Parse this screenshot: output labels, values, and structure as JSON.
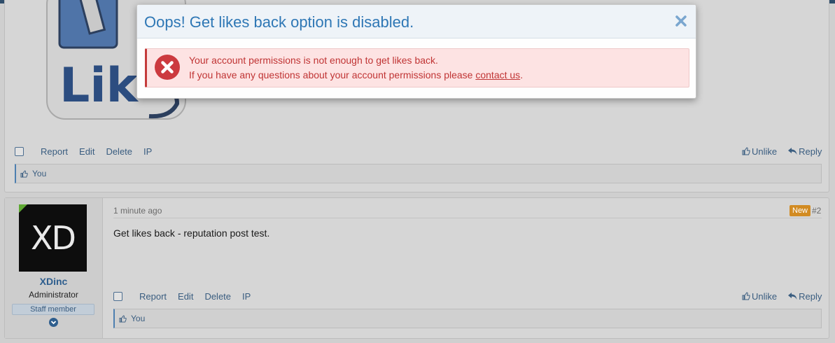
{
  "post1": {
    "image_text": "Lik",
    "actions": {
      "report": "Report",
      "edit": "Edit",
      "delete": "Delete",
      "ip": "IP",
      "unlike": "Unlike",
      "reply": "Reply"
    },
    "likes_text": "You"
  },
  "post2": {
    "avatar_text": "XD",
    "username": "XDinc",
    "user_title": "Administrator",
    "user_badge": "Staff member",
    "time": "1 minute ago",
    "new_badge": "New",
    "post_number": "#2",
    "body": "Get likes back - reputation post test.",
    "actions": {
      "report": "Report",
      "edit": "Edit",
      "delete": "Delete",
      "ip": "IP",
      "unlike": "Unlike",
      "reply": "Reply"
    },
    "likes_text": "You"
  },
  "modal": {
    "title": "Oops! Get likes back option is disabled.",
    "message_line1": "Your account permissions is not enough to get likes back.",
    "message_line2_prefix": "If you have any questions about your account permissions please ",
    "contact_link": "contact us",
    "message_line2_suffix": "."
  },
  "colors": {
    "modal_title": "#2e77b5",
    "error_text": "#c03434",
    "error_bg": "#fde3e3",
    "link": "#3a5d80",
    "new_badge": "#d28b22",
    "username": "#2e5e8e"
  },
  "icons": [
    "close-icon",
    "error-x-icon",
    "thumbs-up-icon",
    "reply-icon",
    "chevron-down-icon"
  ]
}
